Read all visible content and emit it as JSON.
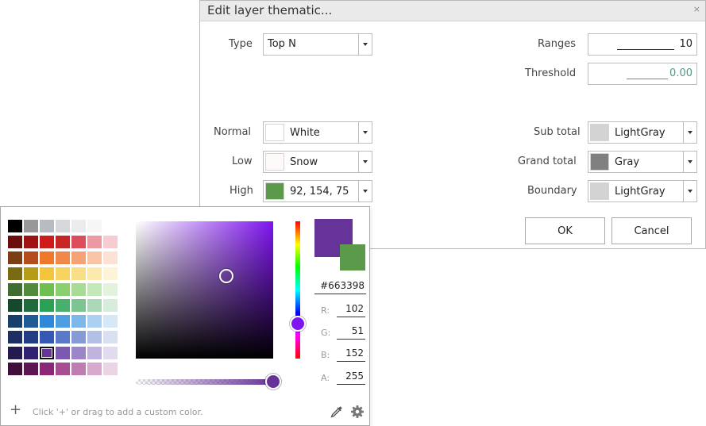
{
  "dialog": {
    "title": "Edit layer thematic...",
    "close_glyph": "×",
    "type_label": "Type",
    "type_value": "Top N",
    "ranges_label": "Ranges",
    "ranges_value": "10",
    "threshold_label": "Threshold",
    "threshold_value": "0.00",
    "normal_label": "Normal",
    "normal_value": "White",
    "normal_color": "#ffffff",
    "low_label": "Low",
    "low_value": "Snow",
    "low_color": "#fffafa",
    "high_label": "High",
    "high_value": "92, 154, 75",
    "high_color": "#5c9a4b",
    "subtotal_label": "Sub total",
    "subtotal_value": "LightGray",
    "subtotal_color": "#d3d3d3",
    "grandtotal_label": "Grand total",
    "grandtotal_value": "Gray",
    "grandtotal_color": "#808080",
    "boundary_label": "Boundary",
    "boundary_value": "LightGray",
    "boundary_color": "#d3d3d3",
    "ok_label": "OK",
    "cancel_label": "Cancel"
  },
  "picker": {
    "palette": [
      [
        "#000000",
        "#989898",
        "#b8bcc2",
        "#d6d8dc",
        "#ececee",
        "#f6f6f6",
        "#ffffff"
      ],
      [
        "#6b0d0d",
        "#9e1212",
        "#cf1a1a",
        "#c82525",
        "#dc4e5c",
        "#ec9aa2",
        "#f7ccd0"
      ],
      [
        "#7b3d14",
        "#b34d1e",
        "#f1772a",
        "#f0884a",
        "#f5a277",
        "#f9c5a7",
        "#fce2d3"
      ],
      [
        "#7a6a12",
        "#b79c17",
        "#f2c53d",
        "#f6d45f",
        "#f8de86",
        "#fbe9ad",
        "#fdf4d6"
      ],
      [
        "#3f6d31",
        "#4f8a3d",
        "#6fbe52",
        "#8ad06e",
        "#a8dc95",
        "#c5e8b8",
        "#e2f3dc"
      ],
      [
        "#16492c",
        "#1f6b3e",
        "#2aa154",
        "#47b06c",
        "#7cc593",
        "#abd9b8",
        "#d6ecdc"
      ],
      [
        "#173f6b",
        "#1f5a95",
        "#2f88d8",
        "#4f9ee2",
        "#7eb8ea",
        "#aad1f2",
        "#d5e8f8"
      ],
      [
        "#1c2e62",
        "#243c84",
        "#3358b6",
        "#5a79c8",
        "#869ad6",
        "#b2c0e5",
        "#d8e0f2"
      ],
      [
        "#231a4f",
        "#302272",
        "#663398",
        "#7b59b3",
        "#9d86c8",
        "#c0b3dd",
        "#e2dbf0"
      ],
      [
        "#3f0e3a",
        "#5c1552",
        "#8a2776",
        "#a74e92",
        "#bf7cb0",
        "#d6a9cd",
        "#ebd4e6"
      ]
    ],
    "selected": "#663398",
    "current_color": "#663398",
    "previous_color": "#5c9a4b",
    "hue_color": "#7e14ef",
    "hex_value": "#663398",
    "r_label": "R:",
    "r_value": "102",
    "g_label": "G:",
    "g_value": "51",
    "b_label": "B:",
    "b_value": "152",
    "a_label": "A:",
    "a_value": "255",
    "alpha_fraction": 1.0,
    "plus_glyph": "+",
    "footer_hint": "Click '+' or drag to add a custom color.",
    "eyedropper_icon": "eyedropper-icon",
    "settings_icon": "gear-icon"
  }
}
